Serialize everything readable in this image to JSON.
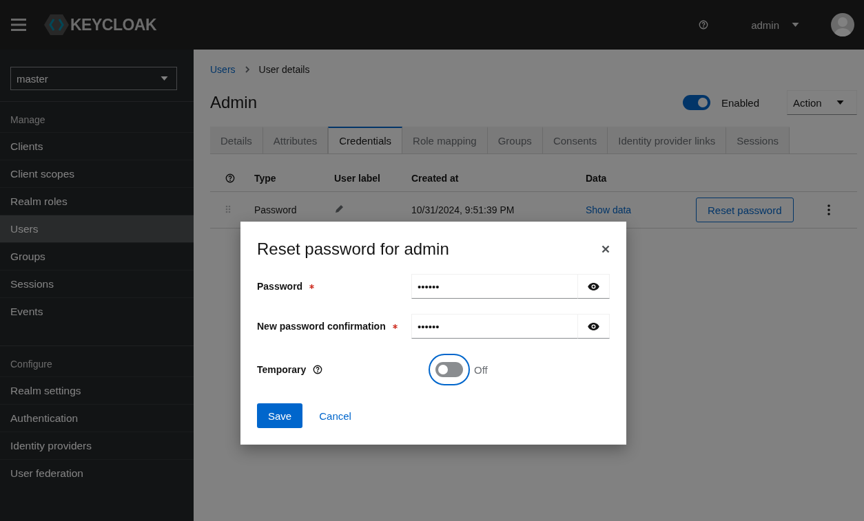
{
  "header": {
    "brand": "KEYCLOAK",
    "user": "admin"
  },
  "sidebar": {
    "realm": "master",
    "sections": [
      {
        "title": "Manage",
        "items": [
          {
            "label": "Clients",
            "selected": false
          },
          {
            "label": "Client scopes",
            "selected": false
          },
          {
            "label": "Realm roles",
            "selected": false
          },
          {
            "label": "Users",
            "selected": true
          },
          {
            "label": "Groups",
            "selected": false
          },
          {
            "label": "Sessions",
            "selected": false
          },
          {
            "label": "Events",
            "selected": false
          }
        ]
      },
      {
        "title": "Configure",
        "items": [
          {
            "label": "Realm settings",
            "selected": false
          },
          {
            "label": "Authentication",
            "selected": false
          },
          {
            "label": "Identity providers",
            "selected": false
          },
          {
            "label": "User federation",
            "selected": false
          }
        ]
      }
    ]
  },
  "breadcrumb": [
    "Users",
    "User details"
  ],
  "page": {
    "title": "Admin",
    "enabled": {
      "label": "Enabled",
      "on": true
    },
    "action": "Action"
  },
  "tabs": [
    {
      "label": "Details",
      "selected": false
    },
    {
      "label": "Attributes",
      "selected": false
    },
    {
      "label": "Credentials",
      "selected": true
    },
    {
      "label": "Role mapping",
      "selected": false
    },
    {
      "label": "Groups",
      "selected": false
    },
    {
      "label": "Consents",
      "selected": false
    },
    {
      "label": "Identity provider links",
      "selected": false
    },
    {
      "label": "Sessions",
      "selected": false
    }
  ],
  "table": {
    "columns": [
      "Type",
      "User label",
      "Created at",
      "Data"
    ],
    "rows": [
      {
        "type": "Password",
        "created_at": "10/31/2024, 9:51:39 PM",
        "data": "Show data",
        "action": "Reset password"
      }
    ]
  },
  "modal": {
    "title": "Reset password for admin",
    "fields": [
      {
        "label": "Password",
        "required": true,
        "value": "••••••"
      },
      {
        "label": "New password confirmation",
        "required": true,
        "value": "••••••"
      }
    ],
    "temporary": {
      "label": "Temporary",
      "on": false,
      "state_label": "Off"
    },
    "buttons": {
      "save": "Save",
      "cancel": "Cancel"
    }
  }
}
